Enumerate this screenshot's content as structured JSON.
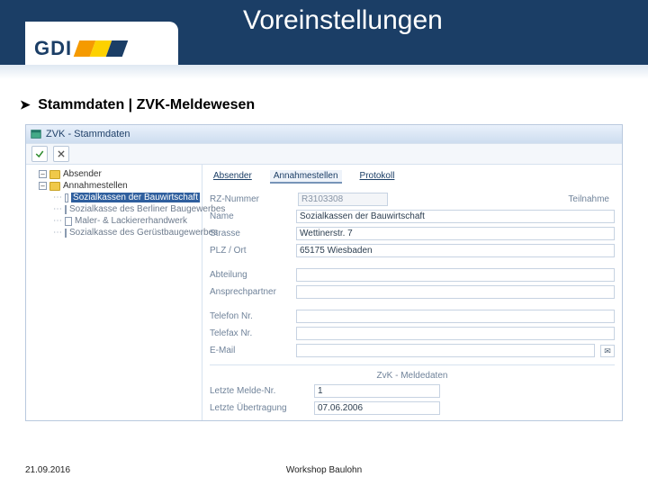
{
  "header": {
    "title": "Voreinstellungen",
    "logo_text": "GDI"
  },
  "section": {
    "arrow": "➤",
    "text": "Stammdaten | ZVK-Meldewesen"
  },
  "window": {
    "title": "ZVK - Stammdaten",
    "tree": {
      "absender": "Absender",
      "annahmestellen": "Annahmestellen",
      "items": [
        "Sozialkassen der Bauwirtschaft",
        "Sozialkasse des Berliner Baugewerbes",
        "Maler- & Lackiererhandwerk",
        "Sozialkasse des Gerüstbaugewerbes"
      ],
      "selected_index": 0
    },
    "tabs": [
      "Absender",
      "Annahmestellen",
      "Protokoll"
    ],
    "active_tab": 1,
    "form": {
      "rz_label": "RZ-Nummer",
      "rz_value": "R3103308",
      "teilnahme_label": "Teilnahme",
      "teilnahme_checked": true,
      "name_label": "Name",
      "name_value": "Sozialkassen der Bauwirtschaft",
      "strasse_label": "Strasse",
      "strasse_value": "Wettinerstr. 7",
      "plz_label": "PLZ / Ort",
      "plz_value": "65175 Wiesbaden",
      "abteilung_label": "Abteilung",
      "abteilung_value": "",
      "ansprech_label": "Ansprechpartner",
      "ansprech_value": "",
      "tel_label": "Telefon Nr.",
      "tel_value": "",
      "fax_label": "Telefax Nr.",
      "fax_value": "",
      "email_label": "E-Mail",
      "email_value": "",
      "meldedaten_header": "ZvK - Meldedaten",
      "meldenr_label": "Letzte Melde-Nr.",
      "meldenr_value": "1",
      "uebertrag_label": "Letzte Übertragung",
      "uebertrag_value": "07.06.2006"
    }
  },
  "footer": {
    "date": "21.09.2016",
    "center": "Workshop Baulohn"
  }
}
